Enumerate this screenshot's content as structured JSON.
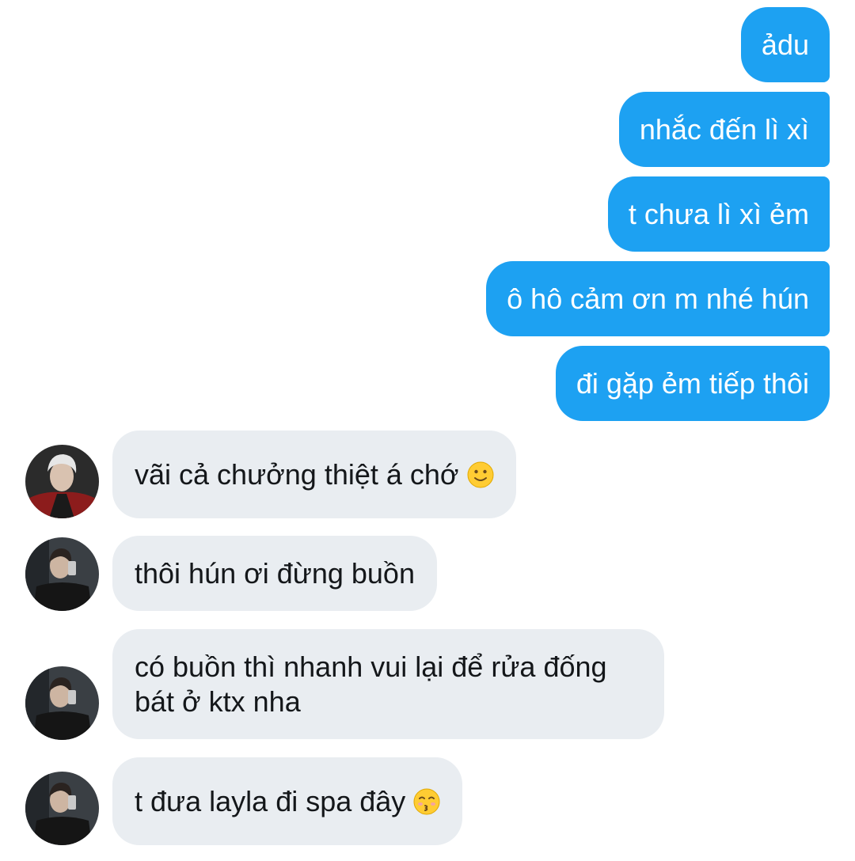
{
  "outgoing": [
    {
      "text": "ảdu"
    },
    {
      "text": "nhắc đến lì xì"
    },
    {
      "text": "t chưa lì xì ẻm"
    },
    {
      "text": "ô hô cảm ơn m nhé hún"
    },
    {
      "text": "đi gặp ẻm tiếp thôi"
    }
  ],
  "incoming": [
    {
      "text": "vãi cả chưởng thiệt á chớ",
      "emoji": "slightly-smiling-face"
    },
    {
      "text": "thôi hún ơi đừng buồn"
    },
    {
      "text": "có buồn thì nhanh vui lại để rửa đống bát ở ktx nha"
    },
    {
      "text": "t đưa layla đi spa đây",
      "emoji": "kissing-face-with-closed-eyes"
    }
  ],
  "colors": {
    "outgoing_bubble": "#1da1f2",
    "incoming_bubble": "#e9edf1",
    "incoming_text": "#14171a"
  }
}
